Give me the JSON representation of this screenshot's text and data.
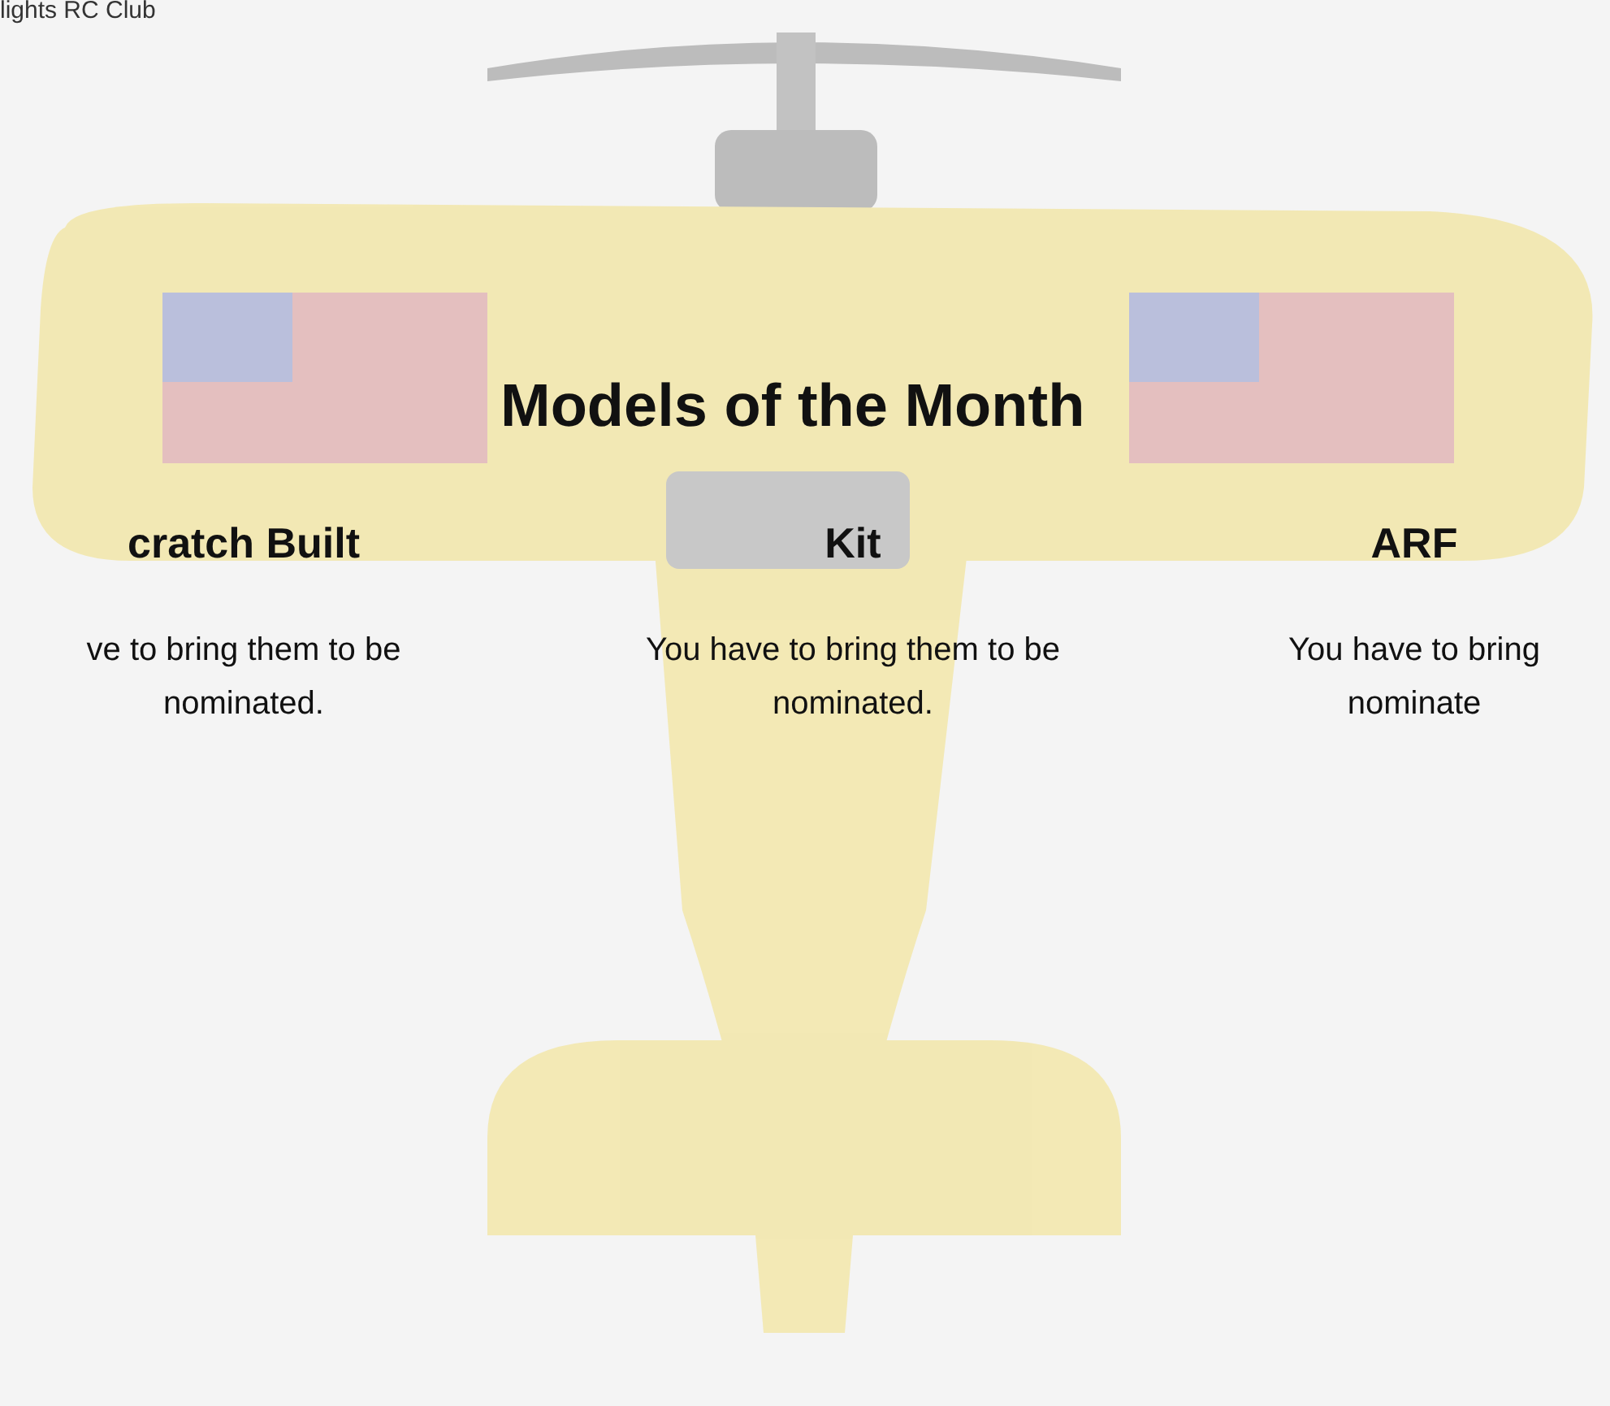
{
  "site_title": "lights RC Club",
  "heading": "Models of the Month",
  "categories": [
    {
      "title": "cratch Built",
      "description_lines": [
        "ve to bring them to be",
        "nominated."
      ]
    },
    {
      "title": "Kit",
      "description_lines": [
        "You have to bring them to be",
        "nominated."
      ]
    },
    {
      "title": "ARF",
      "description_lines": [
        "You have to bring",
        "nominate"
      ]
    }
  ]
}
